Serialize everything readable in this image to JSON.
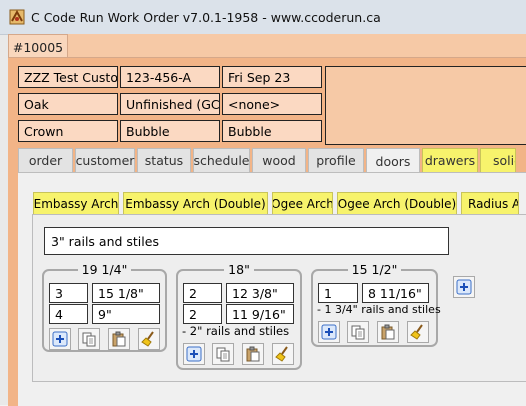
{
  "window": {
    "title": "C Code Run Work Order v7.0.1-1958 - www.ccoderun.ca"
  },
  "order_tab": {
    "label": "#10005"
  },
  "info": {
    "customer": "ZZZ Test Customer",
    "phone": "123-456-A",
    "date": "Fri Sep 23",
    "wood": "Oak",
    "finish": "Unfinished (GC)",
    "other": "<none>",
    "moulding": "Crown",
    "profile1": "Bubble",
    "profile2": "Bubble"
  },
  "tabs": [
    "order",
    "customer",
    "status",
    "schedule",
    "wood",
    "profile",
    "doors",
    "drawers",
    "solid"
  ],
  "door_styles": [
    "Embassy Arch",
    "Embassy Arch (Double)",
    "Ogee Arch",
    "Ogee Arch (Double)",
    "Radius Arch"
  ],
  "style_note": "3\" rails and stiles",
  "groups": [
    {
      "width": "19 1/4\"",
      "rows": [
        {
          "qty": "3",
          "height": "15 1/8\""
        },
        {
          "qty": "4",
          "height": "9\""
        }
      ],
      "note": ""
    },
    {
      "width": "18\"",
      "rows": [
        {
          "qty": "2",
          "height": "12 3/8\""
        },
        {
          "qty": "2",
          "height": "11 9/16\""
        }
      ],
      "note": "- 2\" rails and stiles"
    },
    {
      "width": "15 1/2\"",
      "rows": [
        {
          "qty": "1",
          "height": "8 11/16\""
        }
      ],
      "note": "- 1 3/4\" rails and stiles"
    }
  ],
  "icons": {
    "app": "code-run-icon",
    "add": "add-icon",
    "copy": "copy-icon",
    "paste": "paste-icon",
    "clear": "broom-icon"
  }
}
